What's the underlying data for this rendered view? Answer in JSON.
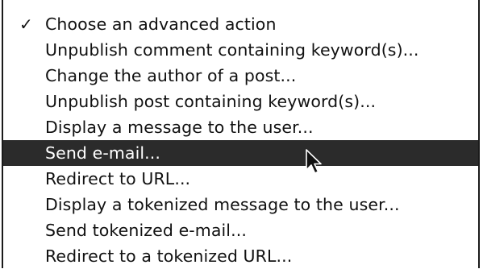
{
  "menu": {
    "checkmark": "✓",
    "items": [
      {
        "label": "Choose an advanced action",
        "checked": true,
        "selected": false
      },
      {
        "label": "Unpublish comment containing keyword(s)...",
        "checked": false,
        "selected": false
      },
      {
        "label": "Change the author of a post...",
        "checked": false,
        "selected": false
      },
      {
        "label": "Unpublish post containing keyword(s)...",
        "checked": false,
        "selected": false
      },
      {
        "label": "Display a message to the user...",
        "checked": false,
        "selected": false
      },
      {
        "label": "Send e-mail...",
        "checked": false,
        "selected": true
      },
      {
        "label": "Redirect to URL...",
        "checked": false,
        "selected": false
      },
      {
        "label": "Display a tokenized message to the user...",
        "checked": false,
        "selected": false
      },
      {
        "label": "Send tokenized e-mail...",
        "checked": false,
        "selected": false
      },
      {
        "label": "Redirect to a tokenized URL...",
        "checked": false,
        "selected": false
      }
    ]
  },
  "colors": {
    "highlight": "#2b2b2b",
    "text": "#111111",
    "highlight_text": "#ffffff"
  },
  "cursor_icon": "arrow-pointer-icon"
}
